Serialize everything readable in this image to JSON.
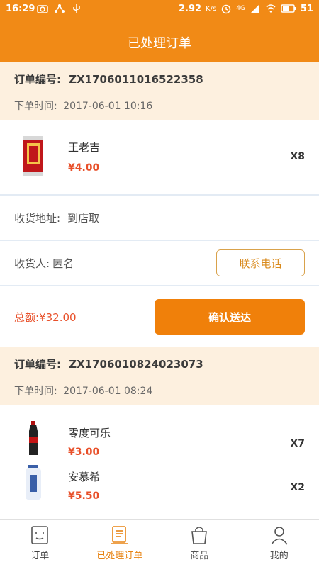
{
  "status_bar": {
    "time": "16:29",
    "network_speed": "2.92",
    "speed_unit": "K/s",
    "signal_label": "4G",
    "battery": "51"
  },
  "header": {
    "title": "已处理订单"
  },
  "orders": [
    {
      "number_label": "订单编号:",
      "number": "ZX1706011016522358",
      "time_label": "下单时间:",
      "time": "2017-06-01 10:16",
      "items": [
        {
          "name": "王老吉",
          "price": "¥4.00",
          "qty": "X8",
          "icon": "herbal-tea-can-icon"
        }
      ],
      "address_label": "收货地址:",
      "address": "到店取",
      "receiver_label": "收货人:",
      "receiver": "匿名",
      "contact_button": "联系电话",
      "total_label": "总额:",
      "total": "¥32.00",
      "confirm_button": "确认送达"
    },
    {
      "number_label": "订单编号:",
      "number": "ZX1706010824023073",
      "time_label": "下单时间:",
      "time": "2017-06-01 08:24",
      "items": [
        {
          "name": "零度可乐",
          "price": "¥3.00",
          "qty": "X7",
          "icon": "cola-bottle-icon"
        },
        {
          "name": "安慕希",
          "price": "¥5.50",
          "qty": "X2",
          "icon": "yogurt-bottle-icon"
        }
      ]
    }
  ],
  "tabs": [
    {
      "label": "订单",
      "icon": "order-face-icon",
      "active": false
    },
    {
      "label": "已处理订单",
      "icon": "processed-orders-icon",
      "active": true
    },
    {
      "label": "商品",
      "icon": "shopping-bag-icon",
      "active": false
    },
    {
      "label": "我的",
      "icon": "user-icon",
      "active": false
    }
  ],
  "colors": {
    "accent": "#f18a16",
    "price": "#e8502a",
    "header_bg": "#fdf0df"
  }
}
